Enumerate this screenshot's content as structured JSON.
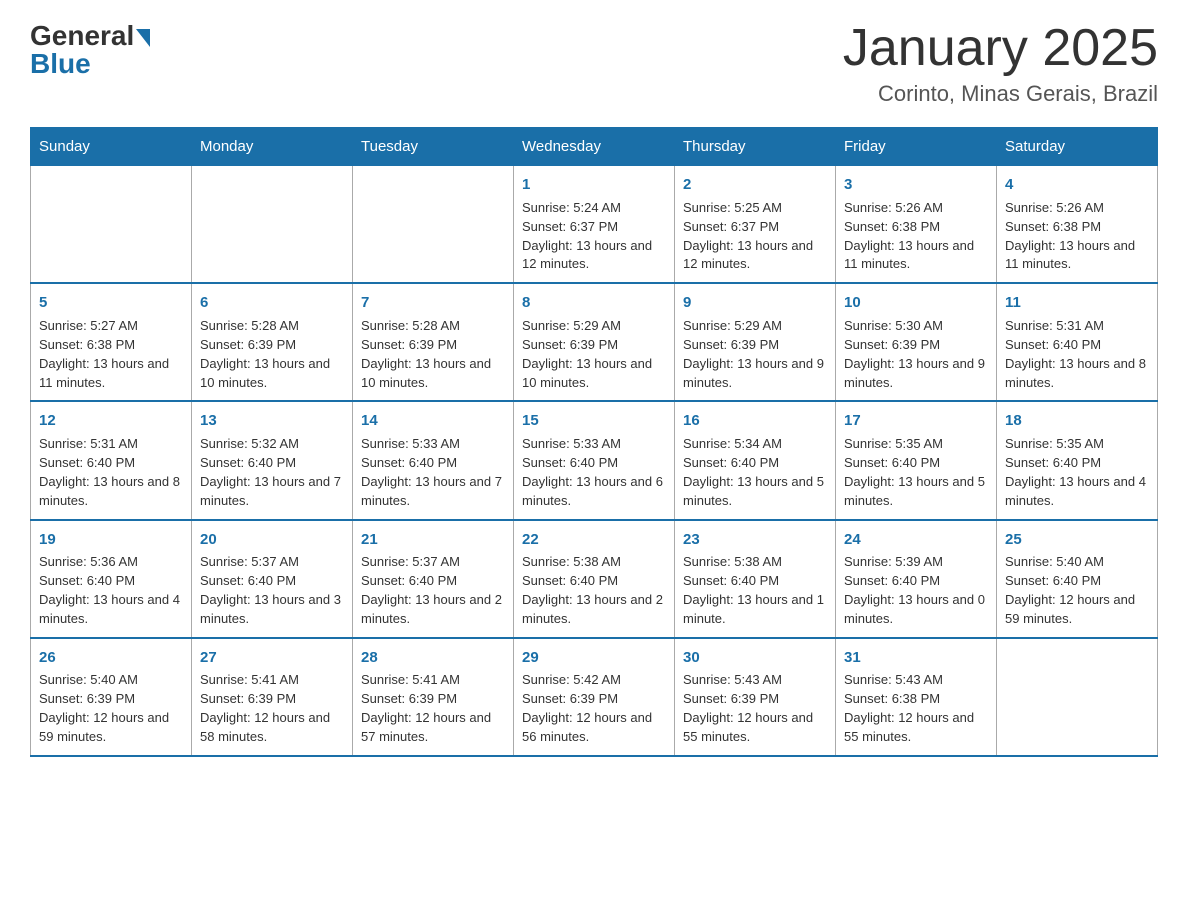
{
  "header": {
    "logo_general": "General",
    "logo_blue": "Blue",
    "title": "January 2025",
    "subtitle": "Corinto, Minas Gerais, Brazil"
  },
  "weekdays": [
    "Sunday",
    "Monday",
    "Tuesday",
    "Wednesday",
    "Thursday",
    "Friday",
    "Saturday"
  ],
  "weeks": [
    [
      {
        "day": "",
        "info": ""
      },
      {
        "day": "",
        "info": ""
      },
      {
        "day": "",
        "info": ""
      },
      {
        "day": "1",
        "info": "Sunrise: 5:24 AM\nSunset: 6:37 PM\nDaylight: 13 hours and 12 minutes."
      },
      {
        "day": "2",
        "info": "Sunrise: 5:25 AM\nSunset: 6:37 PM\nDaylight: 13 hours and 12 minutes."
      },
      {
        "day": "3",
        "info": "Sunrise: 5:26 AM\nSunset: 6:38 PM\nDaylight: 13 hours and 11 minutes."
      },
      {
        "day": "4",
        "info": "Sunrise: 5:26 AM\nSunset: 6:38 PM\nDaylight: 13 hours and 11 minutes."
      }
    ],
    [
      {
        "day": "5",
        "info": "Sunrise: 5:27 AM\nSunset: 6:38 PM\nDaylight: 13 hours and 11 minutes."
      },
      {
        "day": "6",
        "info": "Sunrise: 5:28 AM\nSunset: 6:39 PM\nDaylight: 13 hours and 10 minutes."
      },
      {
        "day": "7",
        "info": "Sunrise: 5:28 AM\nSunset: 6:39 PM\nDaylight: 13 hours and 10 minutes."
      },
      {
        "day": "8",
        "info": "Sunrise: 5:29 AM\nSunset: 6:39 PM\nDaylight: 13 hours and 10 minutes."
      },
      {
        "day": "9",
        "info": "Sunrise: 5:29 AM\nSunset: 6:39 PM\nDaylight: 13 hours and 9 minutes."
      },
      {
        "day": "10",
        "info": "Sunrise: 5:30 AM\nSunset: 6:39 PM\nDaylight: 13 hours and 9 minutes."
      },
      {
        "day": "11",
        "info": "Sunrise: 5:31 AM\nSunset: 6:40 PM\nDaylight: 13 hours and 8 minutes."
      }
    ],
    [
      {
        "day": "12",
        "info": "Sunrise: 5:31 AM\nSunset: 6:40 PM\nDaylight: 13 hours and 8 minutes."
      },
      {
        "day": "13",
        "info": "Sunrise: 5:32 AM\nSunset: 6:40 PM\nDaylight: 13 hours and 7 minutes."
      },
      {
        "day": "14",
        "info": "Sunrise: 5:33 AM\nSunset: 6:40 PM\nDaylight: 13 hours and 7 minutes."
      },
      {
        "day": "15",
        "info": "Sunrise: 5:33 AM\nSunset: 6:40 PM\nDaylight: 13 hours and 6 minutes."
      },
      {
        "day": "16",
        "info": "Sunrise: 5:34 AM\nSunset: 6:40 PM\nDaylight: 13 hours and 5 minutes."
      },
      {
        "day": "17",
        "info": "Sunrise: 5:35 AM\nSunset: 6:40 PM\nDaylight: 13 hours and 5 minutes."
      },
      {
        "day": "18",
        "info": "Sunrise: 5:35 AM\nSunset: 6:40 PM\nDaylight: 13 hours and 4 minutes."
      }
    ],
    [
      {
        "day": "19",
        "info": "Sunrise: 5:36 AM\nSunset: 6:40 PM\nDaylight: 13 hours and 4 minutes."
      },
      {
        "day": "20",
        "info": "Sunrise: 5:37 AM\nSunset: 6:40 PM\nDaylight: 13 hours and 3 minutes."
      },
      {
        "day": "21",
        "info": "Sunrise: 5:37 AM\nSunset: 6:40 PM\nDaylight: 13 hours and 2 minutes."
      },
      {
        "day": "22",
        "info": "Sunrise: 5:38 AM\nSunset: 6:40 PM\nDaylight: 13 hours and 2 minutes."
      },
      {
        "day": "23",
        "info": "Sunrise: 5:38 AM\nSunset: 6:40 PM\nDaylight: 13 hours and 1 minute."
      },
      {
        "day": "24",
        "info": "Sunrise: 5:39 AM\nSunset: 6:40 PM\nDaylight: 13 hours and 0 minutes."
      },
      {
        "day": "25",
        "info": "Sunrise: 5:40 AM\nSunset: 6:40 PM\nDaylight: 12 hours and 59 minutes."
      }
    ],
    [
      {
        "day": "26",
        "info": "Sunrise: 5:40 AM\nSunset: 6:39 PM\nDaylight: 12 hours and 59 minutes."
      },
      {
        "day": "27",
        "info": "Sunrise: 5:41 AM\nSunset: 6:39 PM\nDaylight: 12 hours and 58 minutes."
      },
      {
        "day": "28",
        "info": "Sunrise: 5:41 AM\nSunset: 6:39 PM\nDaylight: 12 hours and 57 minutes."
      },
      {
        "day": "29",
        "info": "Sunrise: 5:42 AM\nSunset: 6:39 PM\nDaylight: 12 hours and 56 minutes."
      },
      {
        "day": "30",
        "info": "Sunrise: 5:43 AM\nSunset: 6:39 PM\nDaylight: 12 hours and 55 minutes."
      },
      {
        "day": "31",
        "info": "Sunrise: 5:43 AM\nSunset: 6:38 PM\nDaylight: 12 hours and 55 minutes."
      },
      {
        "day": "",
        "info": ""
      }
    ]
  ]
}
